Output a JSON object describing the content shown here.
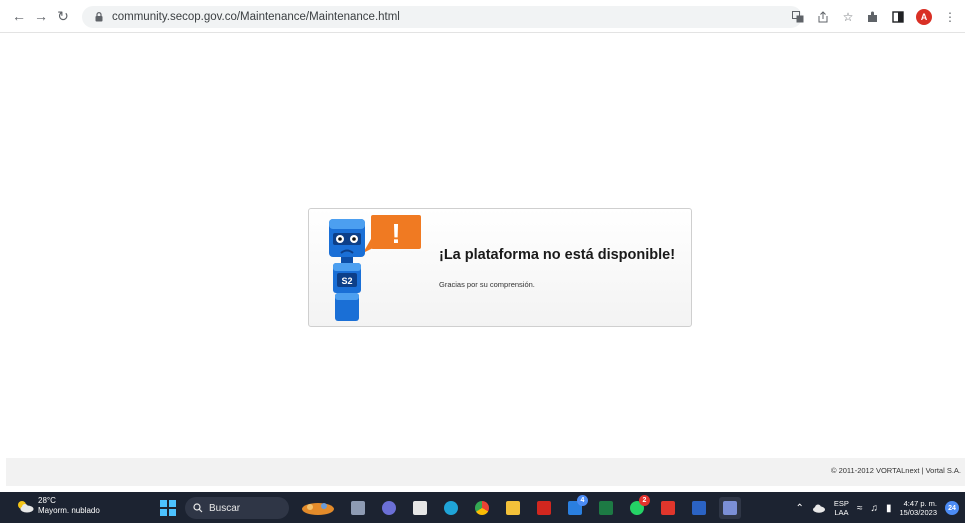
{
  "browser": {
    "url": "community.secop.gov.co/Maintenance/Maintenance.html",
    "profile_initial": "A",
    "icons": [
      "back-icon",
      "forward-icon",
      "reload-icon",
      "lock-icon",
      "translate-icon",
      "share-icon",
      "star-icon",
      "extensions-icon",
      "sidepanel-icon",
      "menu-icon"
    ]
  },
  "card": {
    "title": "¡La plataforma no está disponible!",
    "subtitle": "Gracias por su comprensión.",
    "mascot_label": "S2",
    "exclamation": "!"
  },
  "footer": {
    "text": "© 2011-2012 VORTALnext | Vortal S.A."
  },
  "taskbar": {
    "weather_temp": "28°C",
    "weather_desc": "Mayorm. nublado",
    "search_label": "Buscar",
    "mail_badge": "4",
    "whatsapp_badge": "2",
    "lang_top": "ESP",
    "lang_bottom": "LAA",
    "time": "4:47 p. m.",
    "date": "15/03/2023",
    "notifications": "24"
  },
  "colors": {
    "accent_blue": "#1a6fd6",
    "mascot_orange": "#f07a22",
    "taskbar_bg": "#1c2331"
  }
}
